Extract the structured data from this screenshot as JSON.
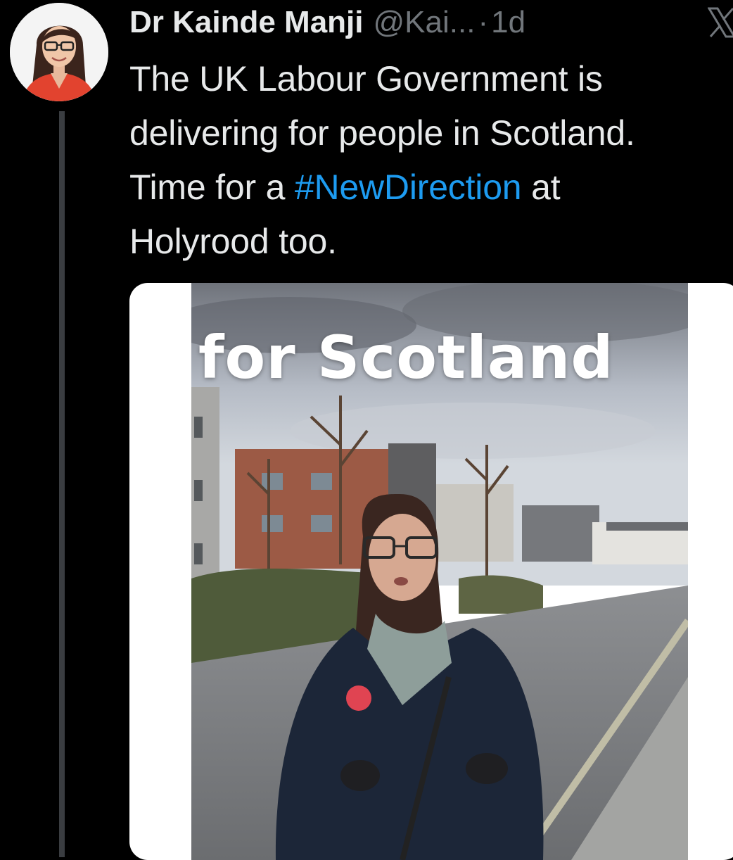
{
  "author": {
    "display_name": "Dr Kainde Manji",
    "handle": "@Kai...",
    "separator": "·",
    "timestamp": "1d",
    "avatar_icon": "profile-photo-icon"
  },
  "post": {
    "text_before_hashtag": "The UK Labour Government is\ndelivering for people in Scotland.\nTime for a ",
    "hashtag": "#NewDirection",
    "text_after_hashtag": " at\nHolyrood too."
  },
  "media": {
    "type": "video",
    "overlay_caption": "for Scotland"
  },
  "icons": {
    "platform": "x-logo-icon"
  },
  "colors": {
    "background": "#000000",
    "primary_text": "#e7e9ea",
    "secondary_text": "#71767b",
    "hashtag": "#1d9bf0",
    "thread_line": "#3a3d41"
  }
}
